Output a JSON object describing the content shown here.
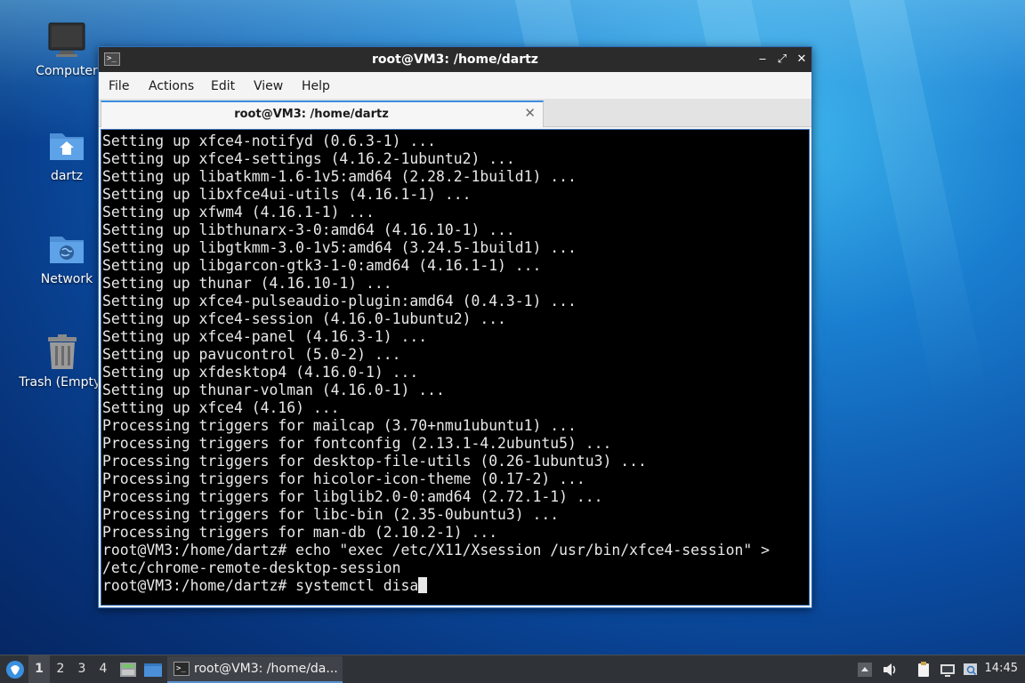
{
  "desktop": {
    "icons": [
      {
        "label": "Computer",
        "icon": "computer-icon"
      },
      {
        "label": "dartz",
        "icon": "home-folder-icon"
      },
      {
        "label": "Network",
        "icon": "network-folder-icon"
      },
      {
        "label": "Trash (Empty)",
        "icon": "trash-icon"
      }
    ]
  },
  "window": {
    "title": "root@VM3: /home/dartz",
    "controls": {
      "minimize": "‒",
      "maximize": "⤢",
      "close": "✕"
    },
    "menu": [
      "File",
      "Actions",
      "Edit",
      "View",
      "Help"
    ],
    "tab": {
      "label": "root@VM3: /home/dartz",
      "close": "✕"
    }
  },
  "terminal": {
    "lines": [
      "Setting up xfce4-notifyd (0.6.3-1) ...",
      "Setting up xfce4-settings (4.16.2-1ubuntu2) ...",
      "Setting up libatkmm-1.6-1v5:amd64 (2.28.2-1build1) ...",
      "Setting up libxfce4ui-utils (4.16.1-1) ...",
      "Setting up xfwm4 (4.16.1-1) ...",
      "Setting up libthunarx-3-0:amd64 (4.16.10-1) ...",
      "Setting up libgtkmm-3.0-1v5:amd64 (3.24.5-1build1) ...",
      "Setting up libgarcon-gtk3-1-0:amd64 (4.16.1-1) ...",
      "Setting up thunar (4.16.10-1) ...",
      "Setting up xfce4-pulseaudio-plugin:amd64 (0.4.3-1) ...",
      "Setting up xfce4-session (4.16.0-1ubuntu2) ...",
      "Setting up xfce4-panel (4.16.3-1) ...",
      "Setting up pavucontrol (5.0-2) ...",
      "Setting up xfdesktop4 (4.16.0-1) ...",
      "Setting up thunar-volman (4.16.0-1) ...",
      "Setting up xfce4 (4.16) ...",
      "Processing triggers for mailcap (3.70+nmu1ubuntu1) ...",
      "Processing triggers for fontconfig (2.13.1-4.2ubuntu5) ...",
      "Processing triggers for desktop-file-utils (0.26-1ubuntu3) ...",
      "Processing triggers for hicolor-icon-theme (0.17-2) ...",
      "Processing triggers for libglib2.0-0:amd64 (2.72.1-1) ...",
      "Processing triggers for libc-bin (2.35-0ubuntu3) ...",
      "Processing triggers for man-db (2.10.2-1) ...",
      "root@VM3:/home/dartz# echo \"exec /etc/X11/Xsession /usr/bin/xfce4-session\" >",
      "/etc/chrome-remote-desktop-session"
    ],
    "prompt": "root@VM3:/home/dartz# ",
    "current_input": "systemctl disa"
  },
  "taskbar": {
    "workspaces": [
      "1",
      "2",
      "3",
      "4"
    ],
    "active_workspace": "1",
    "task_label": "root@VM3: /home/da...",
    "clock": "14:45",
    "tray_icons": [
      "scroll-up-icon",
      "volume-icon",
      "clipboard-icon",
      "network-icon",
      "search-window-icon"
    ]
  },
  "colors": {
    "terminal_bg": "#000000",
    "terminal_fg": "#e8e8e8",
    "titlebar": "#2b2b2b",
    "accent": "#3b8de0",
    "panel": "#2f3338"
  }
}
